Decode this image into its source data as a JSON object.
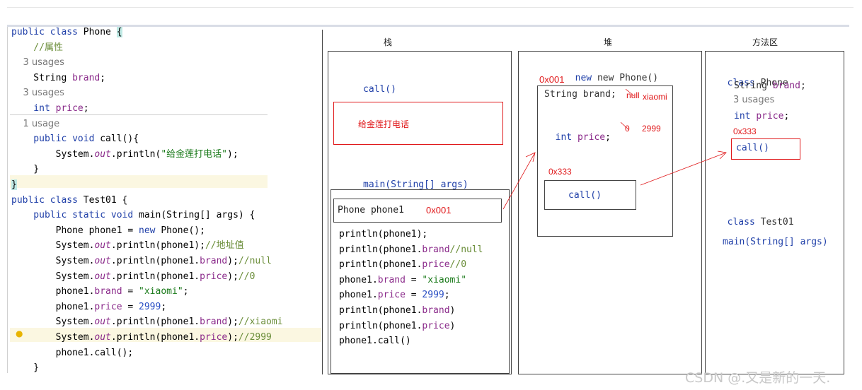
{
  "editor": {
    "lines": [
      {
        "kind": "code",
        "parts": [
          [
            "kw",
            "public class "
          ],
          [
            "",
            "Phone "
          ],
          [
            "brace",
            "{"
          ]
        ]
      },
      {
        "kind": "code",
        "parts": [
          [
            "cmt",
            "    //属性"
          ]
        ]
      },
      {
        "kind": "usage",
        "text": "    3 usages"
      },
      {
        "kind": "code",
        "parts": [
          [
            "",
            "    String "
          ],
          [
            "fld",
            "brand"
          ],
          [
            "",
            ";"
          ]
        ]
      },
      {
        "kind": "usage",
        "text": "    3 usages"
      },
      {
        "kind": "code",
        "parts": [
          [
            "kw",
            "    int "
          ],
          [
            "fld",
            "price"
          ],
          [
            "",
            ";"
          ]
        ]
      },
      {
        "kind": "usage",
        "text": "    1 usage"
      },
      {
        "kind": "code",
        "parts": [
          [
            "kw",
            "    public void "
          ],
          [
            "",
            "call(){"
          ]
        ]
      },
      {
        "kind": "code",
        "parts": [
          [
            "",
            "        System."
          ],
          [
            "it",
            "out"
          ],
          [
            "",
            ".println("
          ],
          [
            "str",
            "\"给金莲打电话\""
          ],
          [
            "",
            ");"
          ]
        ]
      },
      {
        "kind": "code",
        "parts": [
          [
            "",
            "    }"
          ]
        ]
      },
      {
        "kind": "code",
        "parts": [
          [
            "brace",
            "}"
          ]
        ]
      },
      {
        "kind": "code",
        "parts": [
          [
            "kw",
            "public class "
          ],
          [
            "",
            "Test01 {"
          ]
        ]
      },
      {
        "kind": "code",
        "parts": [
          [
            "kw",
            "    public static void "
          ],
          [
            "",
            "main(String[] args) {"
          ]
        ]
      },
      {
        "kind": "code",
        "parts": [
          [
            "",
            "        Phone phone1 = "
          ],
          [
            "kw",
            "new "
          ],
          [
            "",
            "Phone();"
          ]
        ]
      },
      {
        "kind": "code",
        "parts": [
          [
            "",
            "        System."
          ],
          [
            "it",
            "out"
          ],
          [
            "",
            ".println(phone1);"
          ],
          [
            "cmt",
            "//地址值"
          ]
        ]
      },
      {
        "kind": "code",
        "parts": [
          [
            "",
            "        System."
          ],
          [
            "it",
            "out"
          ],
          [
            "",
            ".println(phone1."
          ],
          [
            "fld",
            "brand"
          ],
          [
            "",
            ");"
          ],
          [
            "cmt",
            "//null"
          ]
        ]
      },
      {
        "kind": "code",
        "parts": [
          [
            "",
            "        System."
          ],
          [
            "it",
            "out"
          ],
          [
            "",
            ".println(phone1."
          ],
          [
            "fld",
            "price"
          ],
          [
            "",
            ");"
          ],
          [
            "cmt",
            "//0"
          ]
        ]
      },
      {
        "kind": "code",
        "parts": [
          [
            "",
            "        phone1."
          ],
          [
            "fld",
            "brand"
          ],
          [
            "",
            " = "
          ],
          [
            "str",
            "\"xiaomi\""
          ],
          [
            "",
            ";"
          ]
        ]
      },
      {
        "kind": "code",
        "parts": [
          [
            "",
            "        phone1."
          ],
          [
            "fld",
            "price"
          ],
          [
            "",
            " = "
          ],
          [
            "num",
            "2999"
          ],
          [
            "",
            ";"
          ]
        ]
      },
      {
        "kind": "code",
        "parts": [
          [
            "",
            "        System."
          ],
          [
            "it",
            "out"
          ],
          [
            "",
            ".println(phone1."
          ],
          [
            "fld",
            "brand"
          ],
          [
            "",
            ");"
          ],
          [
            "cmt",
            "//xiaomi"
          ]
        ]
      },
      {
        "kind": "code",
        "parts": [
          [
            "",
            "        System."
          ],
          [
            "it",
            "out"
          ],
          [
            "",
            ".println(phone1."
          ],
          [
            "fld",
            "price"
          ],
          [
            "",
            ");"
          ],
          [
            "cmt",
            "//2999"
          ]
        ]
      },
      {
        "kind": "code",
        "parts": [
          [
            "",
            "        phone1.call();"
          ]
        ]
      },
      {
        "kind": "code",
        "parts": [
          [
            "",
            "    }"
          ]
        ]
      }
    ]
  },
  "stack": {
    "header": "栈",
    "call_frame": "call()",
    "call_body": "给金莲打电话",
    "main_frame": "main(String[] args)",
    "var_label": "Phone phone1",
    "var_addr": "0x001",
    "statements": [
      [
        [
          "",
          "println(phone1);"
        ]
      ],
      [
        [
          "",
          "println(phone1."
        ],
        [
          "fld",
          "brand"
        ],
        [
          ");"
        ],
        [
          "cmt",
          "//null"
        ]
      ],
      [
        [
          "",
          "println(phone1."
        ],
        [
          "fld",
          "price"
        ],
        [
          ");"
        ],
        [
          "cmt",
          "//0"
        ]
      ],
      [
        [
          "",
          "phone1."
        ],
        [
          "fld",
          "brand"
        ],
        [
          "",
          " = "
        ],
        [
          "str",
          "\"xiaomi\""
        ]
      ],
      [
        [
          "",
          "phone1."
        ],
        [
          "fld",
          "price"
        ],
        [
          "",
          " = "
        ],
        [
          "num",
          "2999"
        ],
        [
          "",
          ";"
        ]
      ],
      [
        [
          "",
          "println(phone1."
        ],
        [
          "fld",
          "brand"
        ],
        [
          "",
          ")"
        ]
      ],
      [
        [
          "",
          "println(phone1."
        ],
        [
          "fld",
          "price"
        ],
        [
          "",
          ")"
        ]
      ],
      [
        [
          "",
          "phone1.call()"
        ]
      ]
    ]
  },
  "heap": {
    "header": "堆",
    "new_text": "new Phone()",
    "obj_addr": "0x001",
    "brand_field": "String brand;",
    "brand_old": "null",
    "brand_new": "xiaomi",
    "price_field": "int price;",
    "price_old": "0",
    "price_new": "2999",
    "method_addr": "0x333",
    "method_ref": "call()"
  },
  "method_area": {
    "header": "方法区",
    "class_phone": "class Phone",
    "field_brand": "String brand;",
    "usage": "3 usages",
    "field_price": "int price;",
    "method_addr": "0x333",
    "method_call": "call()",
    "class_test": "class Test01",
    "main_sig": "main(String[] args)"
  },
  "watermark": "CSDN @.又是新的一天."
}
